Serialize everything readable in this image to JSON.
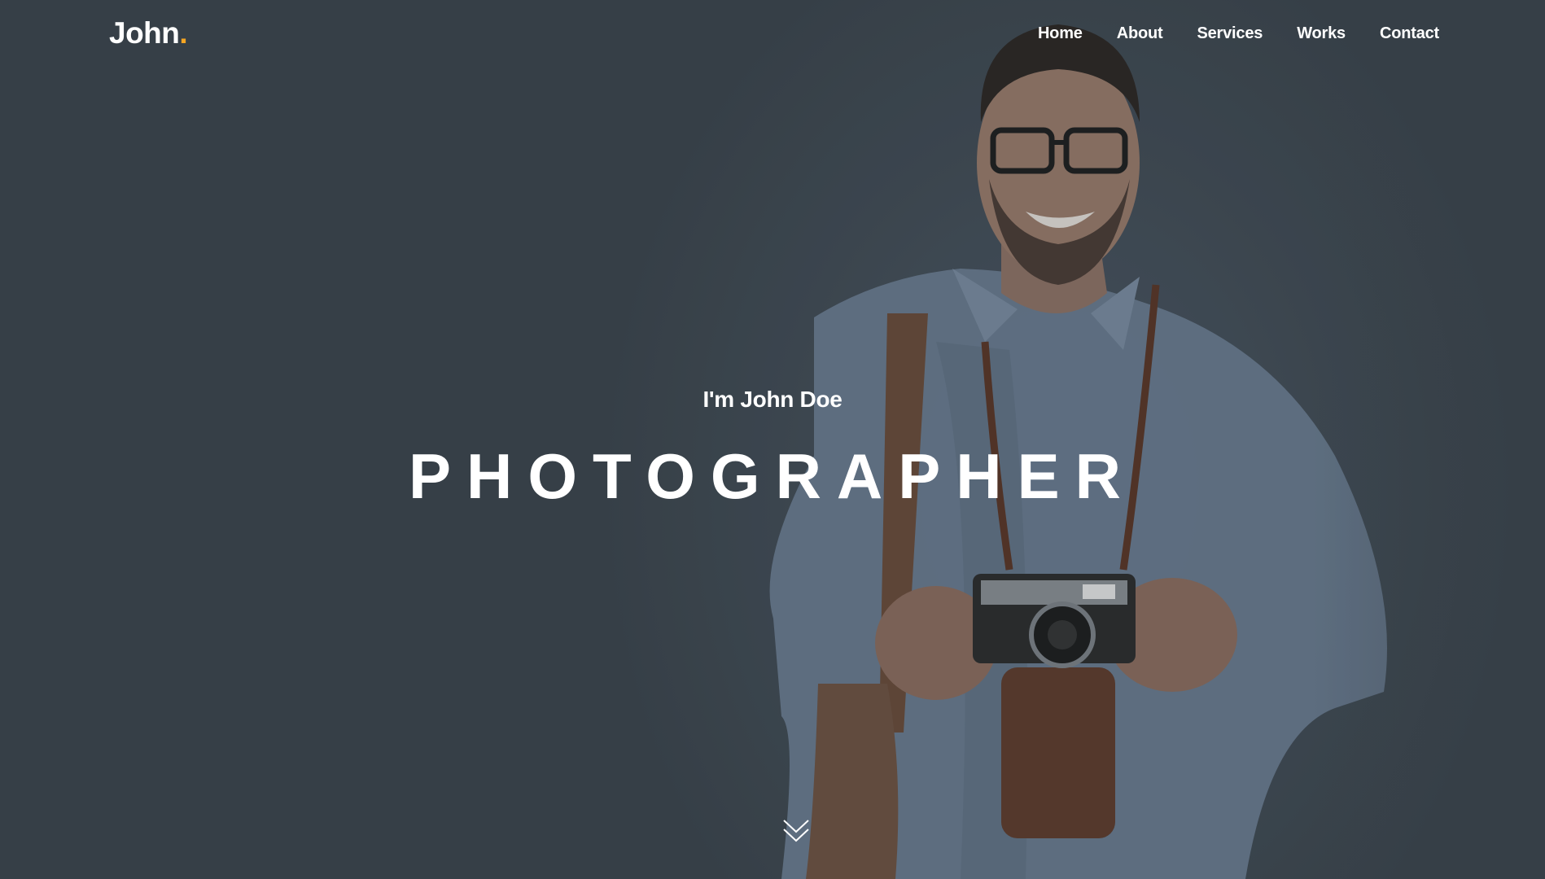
{
  "brand": {
    "name": "John",
    "dot": ".",
    "accent_color": "#f5a623"
  },
  "nav": {
    "items": [
      {
        "label": "Home"
      },
      {
        "label": "About"
      },
      {
        "label": "Services"
      },
      {
        "label": "Works"
      },
      {
        "label": "Contact"
      }
    ]
  },
  "hero": {
    "intro": "I'm John Doe",
    "role": "PHOTOGRAPHER",
    "scroll_icon": "chevron-double-down-icon",
    "background_color": "#3a434b",
    "text_color": "#ffffff"
  }
}
